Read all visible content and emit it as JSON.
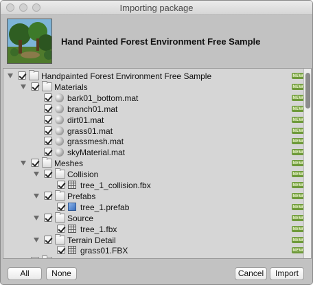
{
  "window": {
    "title": "Importing package"
  },
  "header": {
    "package_name": "Hand Painted Forest Environment Free Sample"
  },
  "tree": {
    "badge_text": "NEW",
    "rows": [
      {
        "label": "Handpainted Forest Environment Free Sample",
        "icon": "folder-icon",
        "indent": 0,
        "expanded": true,
        "checked": true
      },
      {
        "label": "Materials",
        "icon": "folder-icon",
        "indent": 1,
        "expanded": true,
        "checked": true
      },
      {
        "label": "bark01_bottom.mat",
        "icon": "material-sphere-icon",
        "indent": 2,
        "checked": true
      },
      {
        "label": "branch01.mat",
        "icon": "material-sphere-icon",
        "indent": 2,
        "checked": true
      },
      {
        "label": "dirt01.mat",
        "icon": "material-sphere-icon",
        "indent": 2,
        "checked": true
      },
      {
        "label": "grass01.mat",
        "icon": "material-sphere-icon",
        "indent": 2,
        "checked": true
      },
      {
        "label": "grassmesh.mat",
        "icon": "material-sphere-icon",
        "indent": 2,
        "checked": true
      },
      {
        "label": "skyMaterial.mat",
        "icon": "material-sphere-icon",
        "indent": 2,
        "checked": true
      },
      {
        "label": "Meshes",
        "icon": "folder-icon",
        "indent": 1,
        "expanded": true,
        "checked": true
      },
      {
        "label": "Collision",
        "icon": "folder-icon",
        "indent": 2,
        "expanded": true,
        "checked": true
      },
      {
        "label": "tree_1_collision.fbx",
        "icon": "mesh-grid-icon",
        "indent": 3,
        "checked": true
      },
      {
        "label": "Prefabs",
        "icon": "folder-icon",
        "indent": 2,
        "expanded": true,
        "checked": true
      },
      {
        "label": "tree_1.prefab",
        "icon": "prefab-cube-icon",
        "indent": 3,
        "checked": true
      },
      {
        "label": "Source",
        "icon": "folder-icon",
        "indent": 2,
        "expanded": true,
        "checked": true
      },
      {
        "label": "tree_1.fbx",
        "icon": "mesh-grid-icon",
        "indent": 3,
        "checked": true
      },
      {
        "label": "Terrain Detail",
        "icon": "folder-icon",
        "indent": 2,
        "expanded": true,
        "checked": true
      },
      {
        "label": "grass01.FBX",
        "icon": "mesh-grid-icon",
        "indent": 3,
        "checked": true
      },
      {
        "label": "S",
        "icon": "folder-icon",
        "indent": 1,
        "expanded": true,
        "checked": true
      }
    ]
  },
  "footer": {
    "all_label": "All",
    "none_label": "None",
    "cancel_label": "Cancel",
    "import_label": "Import"
  },
  "colors": {
    "badge": "#6e9a3a",
    "window_bg": "#c2c2c2",
    "list_bg": "#d6d6d6"
  }
}
